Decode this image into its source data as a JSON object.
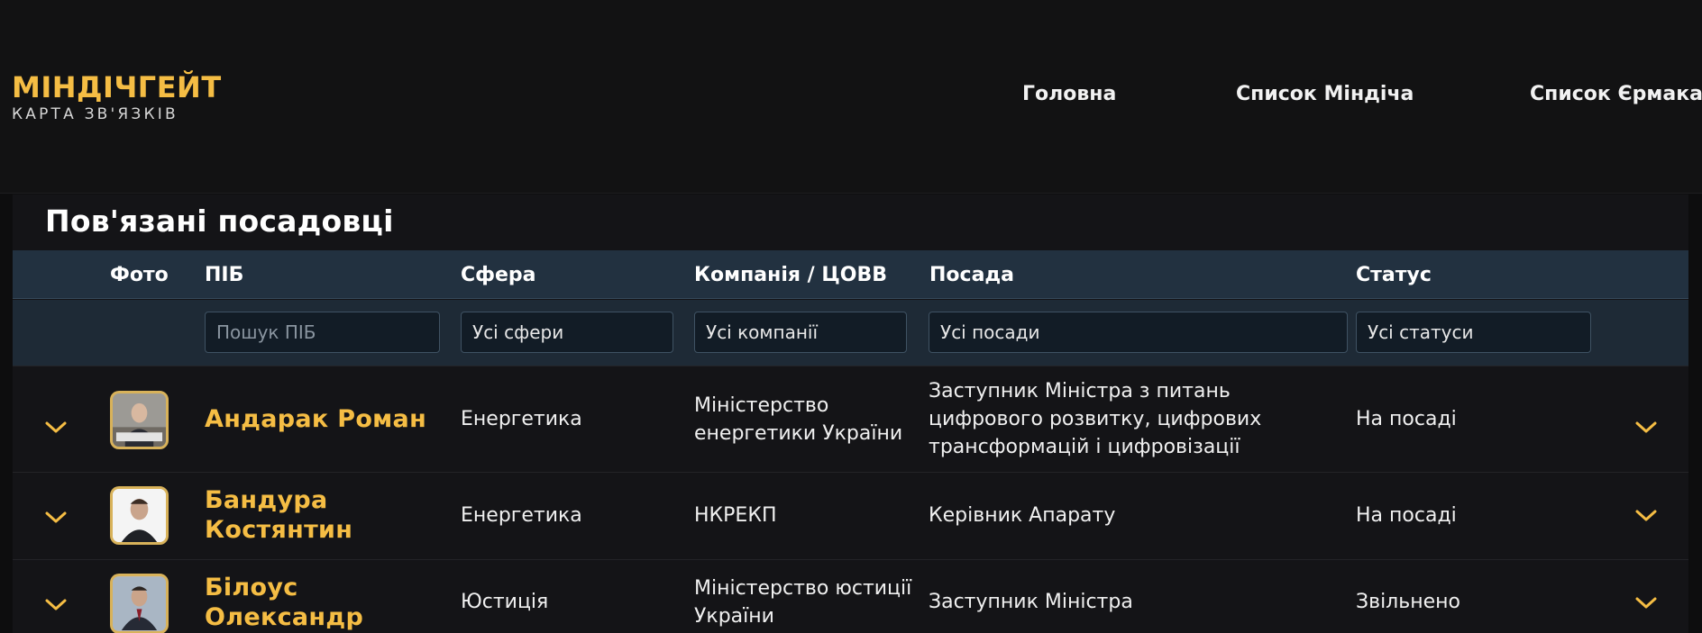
{
  "brand": {
    "title": "МІНДІЧГЕЙТ",
    "subtitle": "КАРТА ЗВ'ЯЗКІВ"
  },
  "nav": [
    {
      "label": "Головна"
    },
    {
      "label": "Список Міндіча"
    },
    {
      "label": "Список Єрмака"
    }
  ],
  "section": {
    "title": "Пов'язані посадовці"
  },
  "table": {
    "headers": {
      "photo": "Фото",
      "name": "ПІБ",
      "sphere": "Сфера",
      "company": "Компанія / ЦОВВ",
      "position": "Посада",
      "status": "Статус"
    },
    "filters": {
      "search_placeholder": "Пошук ПІБ",
      "sphere": "Усі сфери",
      "company": "Усі компанії",
      "position": "Усі посади",
      "status": "Усі статуси"
    },
    "rows": [
      {
        "name": "Андарак Роман",
        "sphere": "Енергетика",
        "company": "Міністерство енергетики України",
        "position": "Заступник Міністра з питань цифрового розвитку, цифрових трансформацій і цифровізації",
        "status": "На посаді"
      },
      {
        "name": "Бандура Костянтин",
        "sphere": "Енергетика",
        "company": "НКРЕКП",
        "position": "Керівник Апарату",
        "status": "На посаді"
      },
      {
        "name": "Білоус Олександр",
        "sphere": "Юстиція",
        "company": "Міністерство юстиції України",
        "position": "Заступник Міністра",
        "status": "Звільнено"
      }
    ]
  },
  "colors": {
    "accent": "#f5bd44",
    "header_bg": "#223140",
    "filter_bg": "#1e2a36"
  },
  "icons": {
    "expand": "chevron-down-icon",
    "details": "chevron-down-icon"
  }
}
